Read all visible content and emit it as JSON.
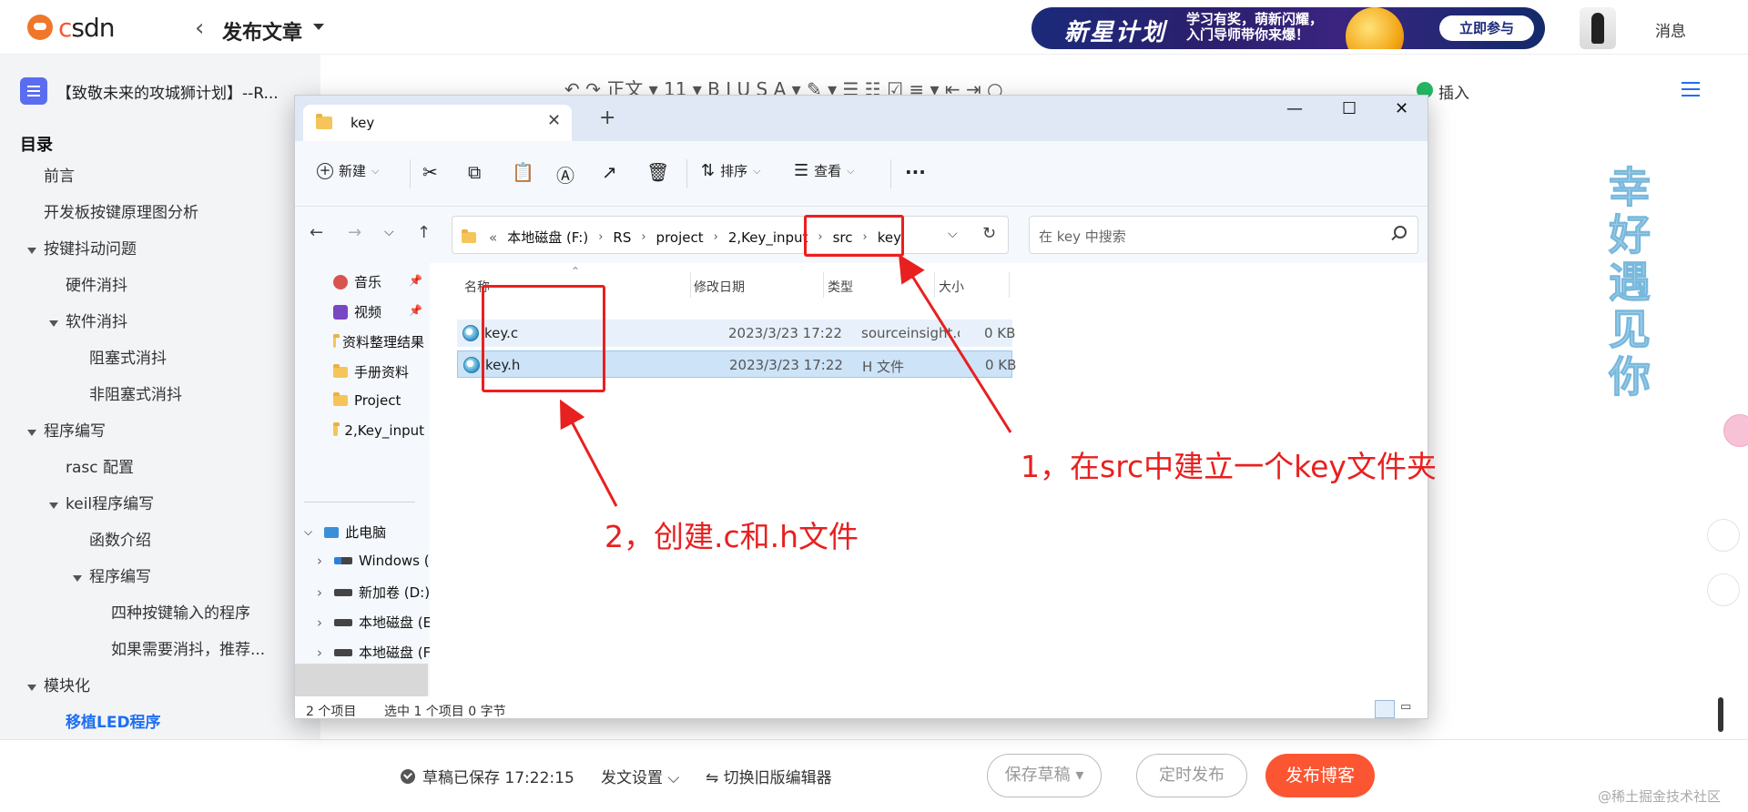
{
  "header": {
    "logo_text_c": "c",
    "logo_text_rest": "sdn",
    "back_glyph": "‹",
    "page_title": "发布文章",
    "banner": {
      "title": "新星计划",
      "line1": "学习有奖，萌新闪耀，",
      "line2": "入门导师带你来爆！",
      "button": "立即参与"
    },
    "messages": "消息"
  },
  "sidebar": {
    "doc_title": "【致敬未来的攻城狮计划】--R...",
    "toc_heading": "目录",
    "toc": [
      {
        "label": "前言",
        "level": 1,
        "caret": false
      },
      {
        "label": "开发板按键原理图分析",
        "level": 1,
        "caret": false
      },
      {
        "label": "按键抖动问题",
        "level": 1,
        "caret": true
      },
      {
        "label": "硬件消抖",
        "level": 2,
        "caret": false
      },
      {
        "label": "软件消抖",
        "level": 2,
        "caret": true
      },
      {
        "label": "阻塞式消抖",
        "level": 3,
        "caret": false
      },
      {
        "label": "非阻塞式消抖",
        "level": 3,
        "caret": false
      },
      {
        "label": "程序编写",
        "level": 1,
        "caret": true
      },
      {
        "label": "rasc 配置",
        "level": 2,
        "caret": false
      },
      {
        "label": "keil程序编写",
        "level": 2,
        "caret": true
      },
      {
        "label": "函数介绍",
        "level": 3,
        "caret": false
      },
      {
        "label": "程序编写",
        "level": 3,
        "caret": true
      },
      {
        "label": "四种按键输入的程序",
        "level": 4,
        "caret": false
      },
      {
        "label": "如果需要消抖，推荐...",
        "level": 4,
        "caret": false
      },
      {
        "label": "模块化",
        "level": 1,
        "caret": true
      },
      {
        "label": "移植LED程序",
        "level": 2,
        "caret": false,
        "active": true
      }
    ]
  },
  "editor": {
    "toolbar_text": "↶  ↷   正文  ▾   11  ▾   B   I   U   S   A ▾   ✎ ▾   ☰   ☷   ☑   ≡ ▾   ⇤   ⇥   ○",
    "insert_label": "插入",
    "side_art": [
      "幸",
      "好",
      "遇",
      "见",
      "你"
    ]
  },
  "explorer": {
    "tab_title": "key",
    "new_tab": "+",
    "window_controls": {
      "minimize": "—",
      "maximize": "☐",
      "close": "✕"
    },
    "commands": {
      "new": "新建",
      "sort": "排序",
      "view": "查看",
      "more": "···"
    },
    "breadcrumb": [
      "«",
      "本地磁盘 (F:)",
      "RS",
      "project",
      "2,Key_input",
      "src",
      "key"
    ],
    "search_placeholder": "在 key 中搜索",
    "nav_items": [
      {
        "label": "音乐",
        "icon": "music-icon",
        "pinned": true
      },
      {
        "label": "视频",
        "icon": "video-icon",
        "pinned": true
      },
      {
        "label": "资料整理结果",
        "icon": "folder-icon",
        "pinned": false
      },
      {
        "label": "手册资料",
        "icon": "folder-icon",
        "pinned": false
      },
      {
        "label": "Project",
        "icon": "folder-icon",
        "pinned": false
      },
      {
        "label": "2,Key_input",
        "icon": "folder-icon",
        "pinned": false
      }
    ],
    "this_pc": "此电脑",
    "drives": [
      {
        "label": "Windows (C:)"
      },
      {
        "label": "新加卷 (D:)"
      },
      {
        "label": "本地磁盘 (E:)"
      },
      {
        "label": "本地磁盘 (F:)",
        "selected": true
      }
    ],
    "columns": [
      "名称",
      "修改日期",
      "类型",
      "大小"
    ],
    "files": [
      {
        "name": "key.c",
        "date": "2023/3/23 17:22",
        "type": "sourceinsight.c_...",
        "size": "0 KB",
        "state": "hover"
      },
      {
        "name": "key.h",
        "date": "2023/3/23 17:22",
        "type": "H 文件",
        "size": "0 KB",
        "state": "selected"
      }
    ],
    "status": {
      "count": "2 个项目",
      "selection": "选中 1 个项目  0 字节"
    }
  },
  "annotations": {
    "note1": "1，在src中建立一个key文件夹",
    "note2": "2，创建.c和.h文件"
  },
  "bottom": {
    "saved": "草稿已保存 17:22:15",
    "fawen": "发文设置",
    "switch": "切换旧版编辑器",
    "save_draft": "保存草稿",
    "timed": "定时发布",
    "publish": "发布博客",
    "watermark": "@稀土掘金技术社区"
  },
  "colors": {
    "accent": "#fc5531",
    "link": "#1e6ff2",
    "annotation": "#e8201f",
    "selection": "#cde3f8"
  }
}
